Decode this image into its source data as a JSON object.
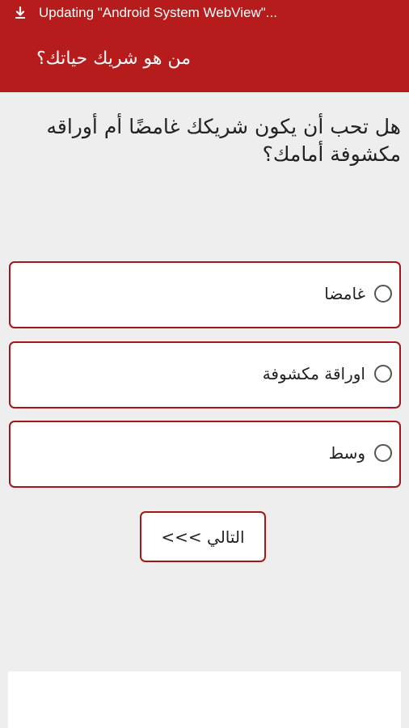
{
  "status_bar": {
    "text": "Updating \"Android System WebView\"...",
    "icon": "download-icon"
  },
  "app_bar": {
    "title": "من هو شريك حياتك؟"
  },
  "question": {
    "text": "هل تحب أن يكون شريكك غامضًا أم أوراقه مكشوفة أمامك؟"
  },
  "options": [
    {
      "label": "غامضا",
      "selected": false
    },
    {
      "label": "اوراقة مكشوفة",
      "selected": false
    },
    {
      "label": "وسط",
      "selected": false
    }
  ],
  "next_button": {
    "label": "التالي >>>"
  },
  "colors": {
    "primary": "#b71c1c",
    "border": "#a4161a",
    "background": "#eeeeee"
  }
}
